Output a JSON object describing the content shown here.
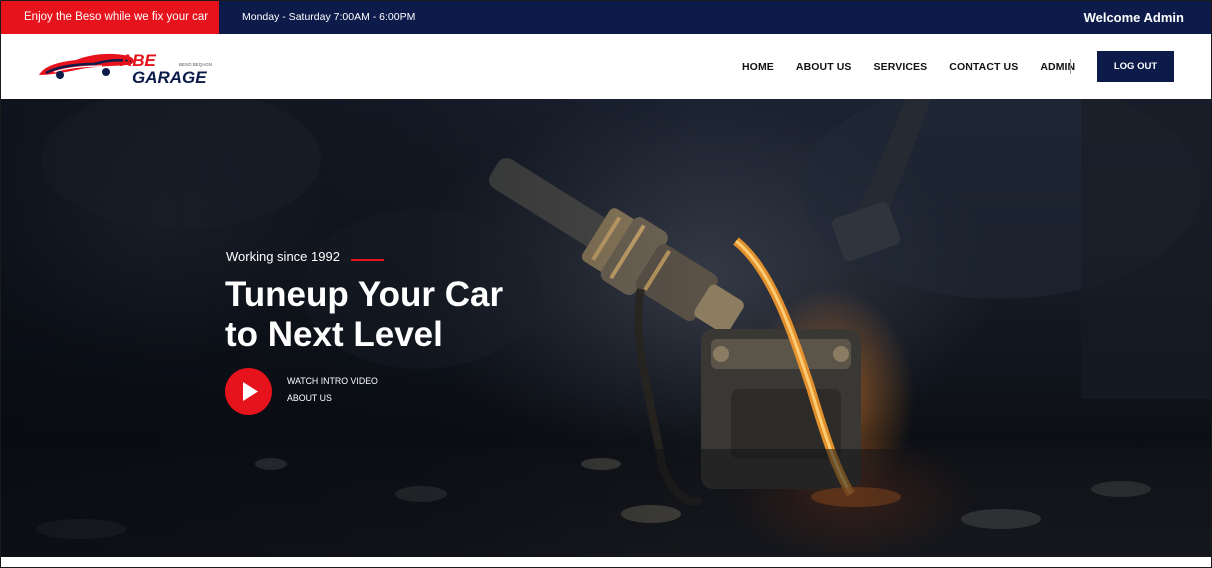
{
  "topbar": {
    "promo": "Enjoy the Beso while we fix your car",
    "hours": "Monday - Saturday 7:00AM - 6:00PM",
    "welcome": "Welcome Admin"
  },
  "logo": {
    "line1": "ABE",
    "line2": "GARAGE",
    "tagline": "BESO BEQAGN"
  },
  "nav": {
    "items": [
      "HOME",
      "ABOUT US",
      "SERVICES",
      "CONTACT US",
      "ADMIN"
    ],
    "logout": "LOG OUT"
  },
  "hero": {
    "since": "Working since 1992",
    "headline_line1": "Tuneup Your Car",
    "headline_line2": "to Next Level",
    "watch": "WATCH INTRO VIDEO",
    "about": "ABOUT US"
  },
  "colors": {
    "brand_red": "#e6121c",
    "brand_navy": "#0d1b4a"
  }
}
